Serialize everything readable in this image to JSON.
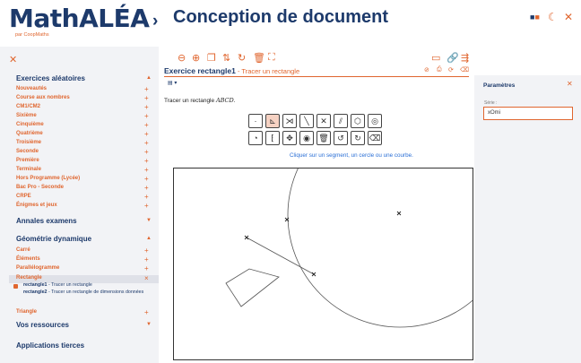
{
  "header": {
    "logo": "MathALÉA",
    "logo_sub": "par CoopMaths",
    "chevron": "›",
    "title": "Conception de document"
  },
  "sidebar": {
    "sections": [
      {
        "label": "Exercices aléatoires",
        "expanded": true
      },
      {
        "label": "Annales examens",
        "expanded": false
      },
      {
        "label": "Géométrie dynamique",
        "expanded": true
      },
      {
        "label": "Vos ressources",
        "expanded": false
      },
      {
        "label": "Applications tierces"
      }
    ],
    "exercices_items": [
      "Nouveautés",
      "Course aux nombres",
      "CM1/CM2",
      "Sixième",
      "Cinquième",
      "Quatrième",
      "Troisième",
      "Seconde",
      "Première",
      "Terminale",
      "Hors Programme (Lycée)",
      "Bac Pro - Seconde",
      "CRPE",
      "Énigmes et jeux"
    ],
    "geo_items": [
      "Carré",
      "Éléments",
      "Parallélogramme",
      "Rectangle",
      "Triangle"
    ],
    "rect_sub": [
      {
        "id": "rectangle1",
        "desc": " - Tracer un rectangle"
      },
      {
        "id": "rectangle2",
        "desc": " - Tracer un rectangle de dimensions données"
      }
    ],
    "plus": "+",
    "minus": "×",
    "caret_up": "▲",
    "caret_down": "▼"
  },
  "exercise": {
    "title": "Exercice rectangle1",
    "subtitle": " - Tracer un rectangle",
    "menu": "▤ ▾",
    "statement_prefix": "Tracer un rectangle ",
    "statement_math": "ABCD",
    "statement_suffix": ".",
    "hint": "Cliquer sur un segment, un cercle ou une courbe."
  },
  "params": {
    "title": "Paramètres",
    "serie_label": "Série :",
    "serie_value": "xOmi"
  },
  "colors": {
    "accent": "#e0662f",
    "navy": "#1d3a6b",
    "panel": "#f2f3f6"
  }
}
